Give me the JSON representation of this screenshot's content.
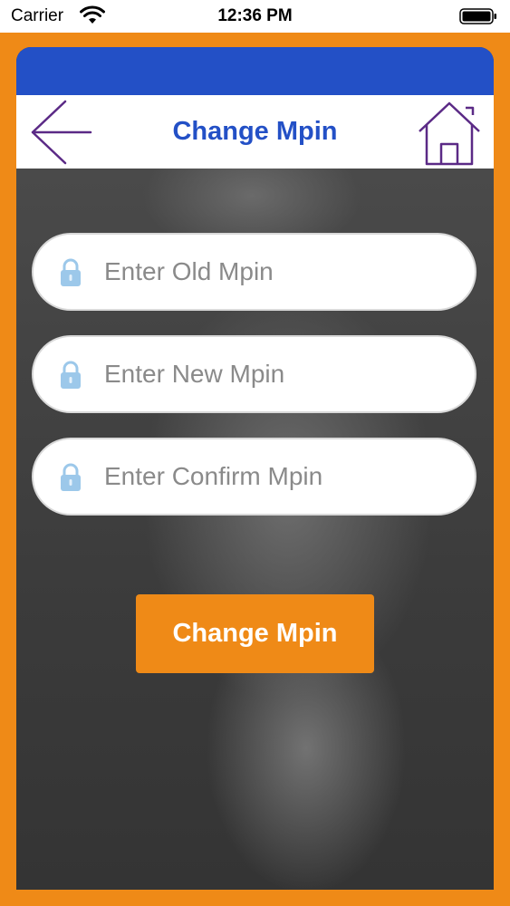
{
  "status_bar": {
    "carrier": "Carrier",
    "time": "12:36 PM"
  },
  "header": {
    "title": "Change Mpin",
    "back_icon": "arrow-left-icon",
    "home_icon": "home-icon"
  },
  "form": {
    "old_mpin": {
      "placeholder": "Enter Old Mpin",
      "value": ""
    },
    "new_mpin": {
      "placeholder": "Enter New Mpin",
      "value": ""
    },
    "confirm_mpin": {
      "placeholder": "Enter Confirm Mpin",
      "value": ""
    },
    "field_icon": "lock-icon",
    "submit_label": "Change Mpin"
  },
  "colors": {
    "frame": "#ef8a17",
    "topbar": "#2350c6",
    "title": "#2350c6",
    "icon_stroke": "#5b2a86",
    "lock": "#9cc8ea",
    "button": "#ef8a17"
  }
}
